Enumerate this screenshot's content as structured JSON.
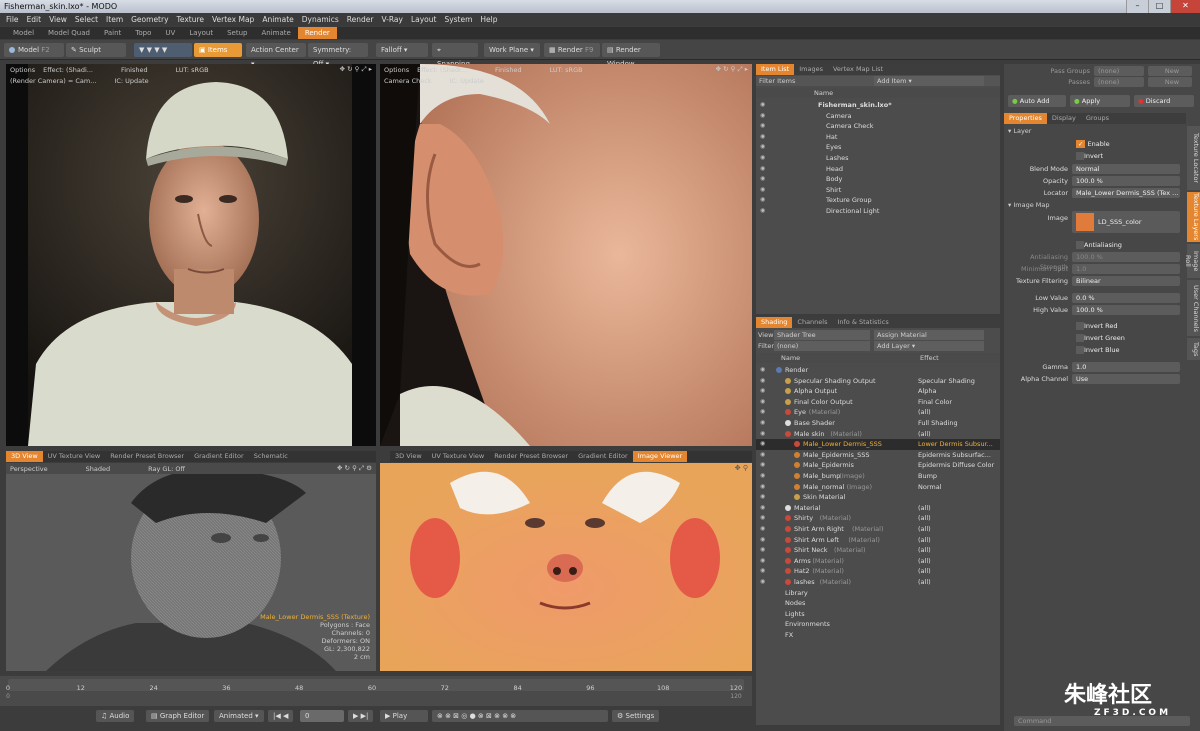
{
  "window": {
    "title": "Fisherman_skin.lxo* - MODO"
  },
  "menu": [
    "File",
    "Edit",
    "View",
    "Select",
    "Item",
    "Geometry",
    "Texture",
    "Vertex Map",
    "Animate",
    "Dynamics",
    "Render",
    "V-Ray",
    "Layout",
    "System",
    "Help"
  ],
  "layout_tabs": [
    "Model",
    "Model Quad",
    "Paint",
    "Topo",
    "UV",
    "Layout",
    "Setup",
    "Animate",
    "Render"
  ],
  "toolbar": {
    "model": "Model",
    "model_key": "F2",
    "sculpt": "Sculpt",
    "items": "Items",
    "action_center": "Action Center",
    "symmetry": "Symmetry: Off",
    "falloff": "Falloff",
    "snapping": "Snapping",
    "work_plane": "Work Plane",
    "render": "Render",
    "render_key": "F9",
    "render_window": "Render Window"
  },
  "viewport_tl": {
    "options": "Options",
    "effect": "Effect: (Shadi...",
    "finished": "Finished",
    "lut": "LUT: sRGB",
    "camera": "(Render Camera) = Cam...",
    "ic": "IC: Update"
  },
  "viewport_tr": {
    "options": "Options",
    "effect": "Effect: (Shadi...",
    "finished": "Finished",
    "lut": "LUT: sRGB",
    "camera": "Camera Check",
    "ic": "IC: Update"
  },
  "bottom_left_tabs": [
    "3D View",
    "UV Texture View",
    "Render Preset Browser",
    "Gradient Editor",
    "Schematic"
  ],
  "viewport_bl": {
    "perspective": "Perspective",
    "shaded": "Shaded",
    "raygl": "Ray GL: Off",
    "info": [
      "Male_Lower Dermis_SSS (Texture)",
      "Polygons : Face",
      "Channels: 0",
      "Deformers: ON",
      "GL: 2,300,822",
      "2 cm"
    ]
  },
  "bottom_right_tabs": [
    "3D View",
    "UV Texture View",
    "Render Preset Browser",
    "Gradient Editor",
    "Image Viewer"
  ],
  "timeline": {
    "ticks": [
      "0",
      "12",
      "24",
      "36",
      "48",
      "60",
      "72",
      "84",
      "96",
      "108",
      "120"
    ],
    "sub": [
      "0",
      "120"
    ],
    "end": "120"
  },
  "bottombar": {
    "audio": "Audio",
    "graph_editor": "Graph Editor",
    "animated": "Animated",
    "frame": "0",
    "play": "Play",
    "settings": "Settings"
  },
  "item_list": {
    "tabs": [
      "Item List",
      "Images",
      "Vertex Map List"
    ],
    "filter": "Filter Items",
    "add": "Add Item",
    "col_name": "Name",
    "items": [
      "Fisherman_skin.lxo*",
      "Camera",
      "Camera Check",
      "Hat",
      "Eyes",
      "Lashes",
      "Head",
      "Body",
      "Shirt",
      "Texture Group",
      "Directional Light"
    ]
  },
  "shading": {
    "tabs": [
      "Shading",
      "Channels",
      "Info & Statistics"
    ],
    "view_label": "View",
    "view_value": "Shader Tree",
    "assign": "Assign Material",
    "filter_label": "Filter",
    "filter_value": "(none)",
    "add_layer": "Add Layer",
    "col_name": "Name",
    "col_effect": "Effect",
    "rows": [
      {
        "name": "Render",
        "type": "",
        "effect": ""
      },
      {
        "name": "Specular Shading Output",
        "type": "",
        "effect": "Specular Shading"
      },
      {
        "name": "Alpha Output",
        "type": "",
        "effect": "Alpha"
      },
      {
        "name": "Final Color Output",
        "type": "",
        "effect": "Final Color"
      },
      {
        "name": "Eye",
        "type": "(Material)",
        "effect": "(all)"
      },
      {
        "name": "Base Shader",
        "type": "",
        "effect": "Full Shading"
      },
      {
        "name": "Male skin",
        "type": "(Material)",
        "effect": "(all)"
      },
      {
        "name": "Male_Lower Dermis_SSS",
        "type": "",
        "effect": "Lower Dermis Subsur..."
      },
      {
        "name": "Male_Epidermis_SSS",
        "type": "",
        "effect": "Epidermis Subsurfac..."
      },
      {
        "name": "Male_Epidermis",
        "type": "",
        "effect": "Epidermis Diffuse Color"
      },
      {
        "name": "Male_bump",
        "type": "(Image)",
        "effect": "Bump"
      },
      {
        "name": "Male_normal",
        "type": "(Image)",
        "effect": "Normal"
      },
      {
        "name": "Skin Material",
        "type": "",
        "effect": ""
      },
      {
        "name": "Material",
        "type": "",
        "effect": "(all)"
      },
      {
        "name": "Shirty",
        "type": "(Material)",
        "effect": "(all)"
      },
      {
        "name": "Shirt Arm Right",
        "type": "(Material)",
        "effect": "(all)"
      },
      {
        "name": "Shirt Arm Left",
        "type": "(Material)",
        "effect": "(all)"
      },
      {
        "name": "Shirt Neck",
        "type": "(Material)",
        "effect": "(all)"
      },
      {
        "name": "Arms",
        "type": "(Material)",
        "effect": "(all)"
      },
      {
        "name": "Hat2",
        "type": "(Material)",
        "effect": "(all)"
      },
      {
        "name": "lashes",
        "type": "(Material)",
        "effect": "(all)"
      },
      {
        "name": "Library",
        "type": "",
        "effect": ""
      },
      {
        "name": "Nodes",
        "type": "",
        "effect": ""
      },
      {
        "name": "Lights",
        "type": "",
        "effect": ""
      },
      {
        "name": "Environments",
        "type": "",
        "effect": ""
      },
      {
        "name": "FX",
        "type": "",
        "effect": ""
      }
    ]
  },
  "properties": {
    "pass_groups": "Pass Groups",
    "passes": "Passes",
    "none": "(none)",
    "new": "New",
    "auto_add": "Auto Add",
    "apply": "Apply",
    "discard": "Discard",
    "tabs": [
      "Properties",
      "Display",
      "Groups"
    ],
    "side_tabs": [
      "Texture Locator",
      "Texture Layers",
      "Image Roll",
      "User Channels",
      "Tags"
    ],
    "layer": "Layer",
    "enable": "Enable",
    "invert": "Invert",
    "blend_mode_label": "Blend Mode",
    "blend_mode": "Normal",
    "opacity_label": "Opacity",
    "opacity": "100.0 %",
    "locator_label": "Locator",
    "locator": "Male_Lower Dermis_SSS (Tex ...",
    "image_map": "Image Map",
    "image_label": "Image",
    "image": "LD_SSS_color",
    "antialiasing": "Antialiasing",
    "aa_strength_label": "Antialiasing Strength",
    "aa_strength": "100.0 %",
    "min_spot_label": "Minimum Spot",
    "min_spot": "1.0",
    "tex_filter_label": "Texture Filtering",
    "tex_filter": "Bilinear",
    "low_label": "Low Value",
    "low": "0.0 %",
    "high_label": "High Value",
    "high": "100.0 %",
    "invert_red": "Invert Red",
    "invert_green": "Invert Green",
    "invert_blue": "Invert Blue",
    "gamma_label": "Gamma",
    "gamma": "1.0",
    "alpha_label": "Alpha Channel",
    "alpha": "Use",
    "command": "Command"
  },
  "watermark": {
    "cn": "朱峰社区",
    "url": "ZF3D.COM"
  }
}
